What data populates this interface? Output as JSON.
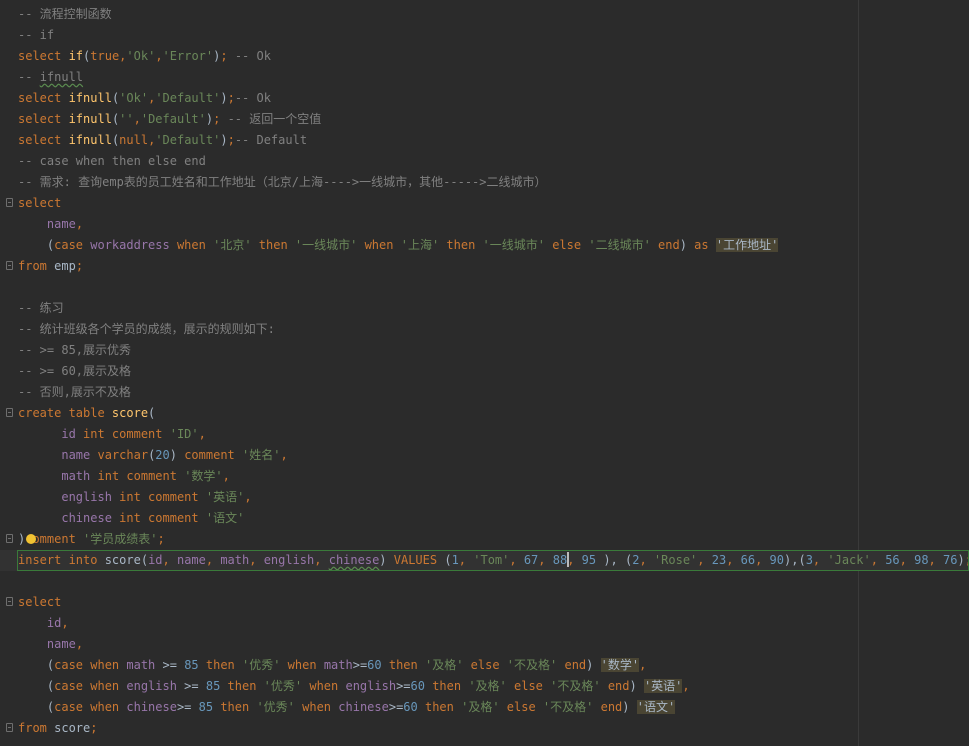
{
  "editor": {
    "language": "SQL",
    "current_line_index": 26,
    "caret": {
      "line_index": 26,
      "after_token_index": 22
    }
  },
  "colors": {
    "background": "#2b2b2b",
    "current_line": "#323232",
    "current_line_border": "#3a7a3a",
    "keyword": "#cc7832",
    "function": "#ffc66d",
    "string": "#6a8759",
    "number": "#6897bb",
    "comment": "#808080",
    "identifier": "#9876aa",
    "plain": "#a9b7c6",
    "alias_highlight": "#4a4533",
    "bulb": "#f1c232"
  },
  "lines": [
    {
      "fold": false,
      "tokens": [
        {
          "t": "-- 流程控制函数",
          "k": "cm"
        }
      ]
    },
    {
      "fold": false,
      "tokens": [
        {
          "t": "-- if",
          "k": "cm"
        }
      ]
    },
    {
      "fold": false,
      "tokens": [
        {
          "t": "select ",
          "k": "kw"
        },
        {
          "t": "if",
          "k": "fn"
        },
        {
          "t": "(",
          "k": "pl"
        },
        {
          "t": "true",
          "k": "kw"
        },
        {
          "t": ",",
          "k": "kw"
        },
        {
          "t": "'Ok'",
          "k": "str"
        },
        {
          "t": ",",
          "k": "kw"
        },
        {
          "t": "'Error'",
          "k": "str"
        },
        {
          "t": ")",
          "k": "pl"
        },
        {
          "t": "; ",
          "k": "kw"
        },
        {
          "t": "-- Ok",
          "k": "cm"
        }
      ]
    },
    {
      "fold": false,
      "tokens": [
        {
          "t": "-- ",
          "k": "cm"
        },
        {
          "t": "ifnull",
          "k": "cm",
          "warn": true
        }
      ]
    },
    {
      "fold": false,
      "tokens": [
        {
          "t": "select ",
          "k": "kw"
        },
        {
          "t": "ifnull",
          "k": "fn"
        },
        {
          "t": "(",
          "k": "pl"
        },
        {
          "t": "'Ok'",
          "k": "str"
        },
        {
          "t": ",",
          "k": "kw"
        },
        {
          "t": "'Default'",
          "k": "str"
        },
        {
          "t": ")",
          "k": "pl"
        },
        {
          "t": ";",
          "k": "kw"
        },
        {
          "t": "-- Ok",
          "k": "cm"
        }
      ]
    },
    {
      "fold": false,
      "tokens": [
        {
          "t": "select ",
          "k": "kw"
        },
        {
          "t": "ifnull",
          "k": "fn"
        },
        {
          "t": "(",
          "k": "pl"
        },
        {
          "t": "''",
          "k": "str"
        },
        {
          "t": ",",
          "k": "kw"
        },
        {
          "t": "'Default'",
          "k": "str"
        },
        {
          "t": ")",
          "k": "pl"
        },
        {
          "t": "; ",
          "k": "kw"
        },
        {
          "t": "-- 返回一个空值",
          "k": "cm"
        }
      ]
    },
    {
      "fold": false,
      "tokens": [
        {
          "t": "select ",
          "k": "kw"
        },
        {
          "t": "ifnull",
          "k": "fn"
        },
        {
          "t": "(",
          "k": "pl"
        },
        {
          "t": "null",
          "k": "kw"
        },
        {
          "t": ",",
          "k": "kw"
        },
        {
          "t": "'Default'",
          "k": "str"
        },
        {
          "t": ")",
          "k": "pl"
        },
        {
          "t": ";",
          "k": "kw"
        },
        {
          "t": "-- Default",
          "k": "cm"
        }
      ]
    },
    {
      "fold": false,
      "tokens": [
        {
          "t": "-- case when then else end",
          "k": "cm"
        }
      ]
    },
    {
      "fold": false,
      "tokens": [
        {
          "t": "-- 需求: 查询emp表的员工姓名和工作地址（北京/上海---->一线城市，其他----->二线城市）",
          "k": "cm"
        }
      ]
    },
    {
      "fold": true,
      "tokens": [
        {
          "t": "select",
          "k": "kw"
        }
      ]
    },
    {
      "fold": false,
      "tokens": [
        {
          "t": "    ",
          "k": "pl"
        },
        {
          "t": "name",
          "k": "id"
        },
        {
          "t": ",",
          "k": "kw"
        }
      ]
    },
    {
      "fold": false,
      "tokens": [
        {
          "t": "    (",
          "k": "pl"
        },
        {
          "t": "case ",
          "k": "kw"
        },
        {
          "t": "workaddress",
          "k": "id"
        },
        {
          "t": " when ",
          "k": "kw"
        },
        {
          "t": "'北京'",
          "k": "str"
        },
        {
          "t": " then ",
          "k": "kw"
        },
        {
          "t": "'一线城市'",
          "k": "str"
        },
        {
          "t": " when ",
          "k": "kw"
        },
        {
          "t": "'上海'",
          "k": "str"
        },
        {
          "t": " then ",
          "k": "kw"
        },
        {
          "t": "'一线城市'",
          "k": "str"
        },
        {
          "t": " else ",
          "k": "kw"
        },
        {
          "t": "'二线城市'",
          "k": "str"
        },
        {
          "t": " end",
          "k": "kw"
        },
        {
          "t": ") ",
          "k": "pl"
        },
        {
          "t": "as ",
          "k": "kw"
        },
        {
          "t": "'工作地址'",
          "k": "alias"
        }
      ]
    },
    {
      "fold": true,
      "tokens": [
        {
          "t": "from ",
          "k": "kw"
        },
        {
          "t": "emp",
          "k": "pl"
        },
        {
          "t": ";",
          "k": "kw"
        }
      ]
    },
    {
      "fold": false,
      "tokens": []
    },
    {
      "fold": false,
      "tokens": [
        {
          "t": "-- 练习",
          "k": "cm"
        }
      ]
    },
    {
      "fold": false,
      "tokens": [
        {
          "t": "-- 统计班级各个学员的成绩，展示的规则如下:",
          "k": "cm"
        }
      ]
    },
    {
      "fold": false,
      "tokens": [
        {
          "t": "-- >= 85,展示优秀",
          "k": "cm"
        }
      ]
    },
    {
      "fold": false,
      "tokens": [
        {
          "t": "-- >= 60,展示及格",
          "k": "cm"
        }
      ]
    },
    {
      "fold": false,
      "tokens": [
        {
          "t": "-- 否则,展示不及格",
          "k": "cm"
        }
      ]
    },
    {
      "fold": true,
      "tokens": [
        {
          "t": "create table ",
          "k": "kw"
        },
        {
          "t": "score",
          "k": "fn"
        },
        {
          "t": "(",
          "k": "pl"
        }
      ]
    },
    {
      "fold": false,
      "tokens": [
        {
          "t": "      ",
          "k": "pl"
        },
        {
          "t": "id",
          "k": "id"
        },
        {
          "t": " int comment ",
          "k": "kw"
        },
        {
          "t": "'ID'",
          "k": "str"
        },
        {
          "t": ",",
          "k": "kw"
        }
      ]
    },
    {
      "fold": false,
      "tokens": [
        {
          "t": "      ",
          "k": "pl"
        },
        {
          "t": "name",
          "k": "id"
        },
        {
          "t": " varchar",
          "k": "kw"
        },
        {
          "t": "(",
          "k": "pl"
        },
        {
          "t": "20",
          "k": "num"
        },
        {
          "t": ") ",
          "k": "pl"
        },
        {
          "t": "comment ",
          "k": "kw"
        },
        {
          "t": "'姓名'",
          "k": "str"
        },
        {
          "t": ",",
          "k": "kw"
        }
      ]
    },
    {
      "fold": false,
      "tokens": [
        {
          "t": "      ",
          "k": "pl"
        },
        {
          "t": "math",
          "k": "id"
        },
        {
          "t": " int comment ",
          "k": "kw"
        },
        {
          "t": "'数学'",
          "k": "str"
        },
        {
          "t": ",",
          "k": "kw"
        }
      ]
    },
    {
      "fold": false,
      "tokens": [
        {
          "t": "      ",
          "k": "pl"
        },
        {
          "t": "english",
          "k": "id"
        },
        {
          "t": " int comment ",
          "k": "kw"
        },
        {
          "t": "'英语'",
          "k": "str"
        },
        {
          "t": ",",
          "k": "kw"
        }
      ]
    },
    {
      "fold": false,
      "tokens": [
        {
          "t": "      ",
          "k": "pl"
        },
        {
          "t": "chinese",
          "k": "id"
        },
        {
          "t": " int comment ",
          "k": "kw"
        },
        {
          "t": "'语文'",
          "k": "str"
        }
      ]
    },
    {
      "fold": true,
      "bulb": true,
      "tokens": [
        {
          "t": ")",
          "k": "pl"
        },
        {
          "t": "comment ",
          "k": "kw"
        },
        {
          "t": "'学员成绩表'",
          "k": "str"
        },
        {
          "t": ";",
          "k": "kw"
        }
      ]
    },
    {
      "fold": false,
      "current": true,
      "tokens": [
        {
          "t": "insert into ",
          "k": "kw"
        },
        {
          "t": "score",
          "k": "pl"
        },
        {
          "t": "(",
          "k": "pl"
        },
        {
          "t": "id",
          "k": "id"
        },
        {
          "t": ", ",
          "k": "kw"
        },
        {
          "t": "name",
          "k": "id"
        },
        {
          "t": ", ",
          "k": "kw"
        },
        {
          "t": "math",
          "k": "id"
        },
        {
          "t": ", ",
          "k": "kw"
        },
        {
          "t": "english",
          "k": "id"
        },
        {
          "t": ", ",
          "k": "kw"
        },
        {
          "t": "chinese",
          "k": "id",
          "warn": true
        },
        {
          "t": ") ",
          "k": "pl"
        },
        {
          "t": "VALUES ",
          "k": "kw"
        },
        {
          "t": "(",
          "k": "pl"
        },
        {
          "t": "1",
          "k": "num"
        },
        {
          "t": ", ",
          "k": "kw"
        },
        {
          "t": "'Tom'",
          "k": "str"
        },
        {
          "t": ", ",
          "k": "kw"
        },
        {
          "t": "67",
          "k": "num"
        },
        {
          "t": ", ",
          "k": "kw"
        },
        {
          "t": "88",
          "k": "num"
        },
        {
          "t": ", ",
          "k": "kw"
        },
        {
          "t": "95",
          "k": "num"
        },
        {
          "t": " ), ",
          "k": "pl"
        },
        {
          "t": "(",
          "k": "pl"
        },
        {
          "t": "2",
          "k": "num"
        },
        {
          "t": ", ",
          "k": "kw"
        },
        {
          "t": "'Rose'",
          "k": "str"
        },
        {
          "t": ", ",
          "k": "kw"
        },
        {
          "t": "23",
          "k": "num"
        },
        {
          "t": ", ",
          "k": "kw"
        },
        {
          "t": "66",
          "k": "num"
        },
        {
          "t": ", ",
          "k": "kw"
        },
        {
          "t": "90",
          "k": "num"
        },
        {
          "t": "),(",
          "k": "pl"
        },
        {
          "t": "3",
          "k": "num"
        },
        {
          "t": ", ",
          "k": "kw"
        },
        {
          "t": "'Jack'",
          "k": "str"
        },
        {
          "t": ", ",
          "k": "kw"
        },
        {
          "t": "56",
          "k": "num"
        },
        {
          "t": ", ",
          "k": "kw"
        },
        {
          "t": "98",
          "k": "num"
        },
        {
          "t": ", ",
          "k": "kw"
        },
        {
          "t": "76",
          "k": "num"
        },
        {
          "t": ")",
          "k": "pl"
        },
        {
          "t": ";",
          "k": "kw"
        }
      ]
    },
    {
      "fold": false,
      "tokens": []
    },
    {
      "fold": true,
      "tokens": [
        {
          "t": "select",
          "k": "kw"
        }
      ]
    },
    {
      "fold": false,
      "tokens": [
        {
          "t": "    ",
          "k": "pl"
        },
        {
          "t": "id",
          "k": "id"
        },
        {
          "t": ",",
          "k": "kw"
        }
      ]
    },
    {
      "fold": false,
      "tokens": [
        {
          "t": "    ",
          "k": "pl"
        },
        {
          "t": "name",
          "k": "id"
        },
        {
          "t": ",",
          "k": "kw"
        }
      ]
    },
    {
      "fold": false,
      "tokens": [
        {
          "t": "    (",
          "k": "pl"
        },
        {
          "t": "case when ",
          "k": "kw"
        },
        {
          "t": "math",
          "k": "id"
        },
        {
          "t": " >= ",
          "k": "pl"
        },
        {
          "t": "85",
          "k": "num"
        },
        {
          "t": " then ",
          "k": "kw"
        },
        {
          "t": "'优秀'",
          "k": "str"
        },
        {
          "t": " when ",
          "k": "kw"
        },
        {
          "t": "math",
          "k": "id"
        },
        {
          "t": ">=",
          "k": "pl"
        },
        {
          "t": "60",
          "k": "num"
        },
        {
          "t": " then ",
          "k": "kw"
        },
        {
          "t": "'及格'",
          "k": "str"
        },
        {
          "t": " else ",
          "k": "kw"
        },
        {
          "t": "'不及格'",
          "k": "str"
        },
        {
          "t": " end",
          "k": "kw"
        },
        {
          "t": ") ",
          "k": "pl"
        },
        {
          "t": "'数学'",
          "k": "alias"
        },
        {
          "t": ",",
          "k": "kw"
        }
      ]
    },
    {
      "fold": false,
      "tokens": [
        {
          "t": "    (",
          "k": "pl"
        },
        {
          "t": "case when ",
          "k": "kw"
        },
        {
          "t": "english",
          "k": "id"
        },
        {
          "t": " >= ",
          "k": "pl"
        },
        {
          "t": "85",
          "k": "num"
        },
        {
          "t": " then ",
          "k": "kw"
        },
        {
          "t": "'优秀'",
          "k": "str"
        },
        {
          "t": " when ",
          "k": "kw"
        },
        {
          "t": "english",
          "k": "id"
        },
        {
          "t": ">=",
          "k": "pl"
        },
        {
          "t": "60",
          "k": "num"
        },
        {
          "t": " then ",
          "k": "kw"
        },
        {
          "t": "'及格'",
          "k": "str"
        },
        {
          "t": " else ",
          "k": "kw"
        },
        {
          "t": "'不及格'",
          "k": "str"
        },
        {
          "t": " end",
          "k": "kw"
        },
        {
          "t": ") ",
          "k": "pl"
        },
        {
          "t": "'英语'",
          "k": "alias"
        },
        {
          "t": ",",
          "k": "kw"
        }
      ]
    },
    {
      "fold": false,
      "tokens": [
        {
          "t": "    (",
          "k": "pl"
        },
        {
          "t": "case when ",
          "k": "kw"
        },
        {
          "t": "chinese",
          "k": "id"
        },
        {
          "t": ">= ",
          "k": "pl"
        },
        {
          "t": "85",
          "k": "num"
        },
        {
          "t": " then ",
          "k": "kw"
        },
        {
          "t": "'优秀'",
          "k": "str"
        },
        {
          "t": " when ",
          "k": "kw"
        },
        {
          "t": "chinese",
          "k": "id"
        },
        {
          "t": ">=",
          "k": "pl"
        },
        {
          "t": "60",
          "k": "num"
        },
        {
          "t": " then ",
          "k": "kw"
        },
        {
          "t": "'及格'",
          "k": "str"
        },
        {
          "t": " else ",
          "k": "kw"
        },
        {
          "t": "'不及格'",
          "k": "str"
        },
        {
          "t": " end",
          "k": "kw"
        },
        {
          "t": ") ",
          "k": "pl"
        },
        {
          "t": "'语文'",
          "k": "alias"
        }
      ]
    },
    {
      "fold": true,
      "tokens": [
        {
          "t": "from ",
          "k": "kw"
        },
        {
          "t": "score",
          "k": "pl"
        },
        {
          "t": ";",
          "k": "kw"
        }
      ]
    }
  ]
}
